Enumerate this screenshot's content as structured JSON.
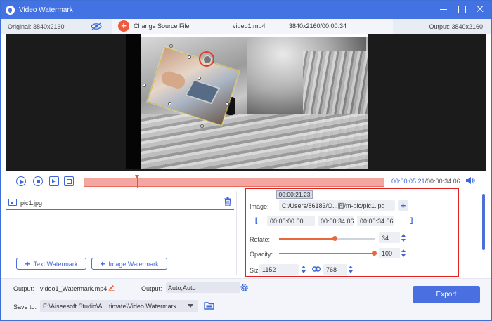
{
  "window": {
    "title": "Video Watermark"
  },
  "info": {
    "original": "Original: 3840x2160",
    "change_source": "Change Source File",
    "file_name": "video1.mp4",
    "file_meta": "3840x2160/00:00:34",
    "output": "Output: 3840x2160"
  },
  "playback": {
    "current_time": "00:00:05.21",
    "total_time": "/00:00:34.06",
    "tooltip_time": "00:00:21.23",
    "playhead_progress": 0.175
  },
  "watermark_list": {
    "items": [
      {
        "name": "pic1.jpg"
      }
    ],
    "text_btn": "Text Watermark",
    "image_btn": "Image Watermark"
  },
  "settings": {
    "image_label": "Image:",
    "image_path": "C:/Users/86183/O...面/m-pic/pic1.jpg",
    "start_time": "00:00:00.00",
    "end_time": "00:00:34.06",
    "duration": "00:00:34.06",
    "rotate_label": "Rotate:",
    "rotate_value": "34",
    "rotate_fraction": 0.58,
    "opacity_label": "Opacity:",
    "opacity_value": "100",
    "opacity_fraction": 1.0,
    "size_label": "Size:",
    "width": "1152",
    "height": "768"
  },
  "bottom": {
    "output_label": "Output:",
    "output_name": "video1_Watermark.mp4",
    "output2_label": "Output:",
    "output_format": "Auto;Auto",
    "save_to_label": "Save to:",
    "save_path": "E:\\Aiseesoft Studio\\Ai...timate\\Video Watermark",
    "export_label": "Export"
  },
  "colors": {
    "accent": "#4372e3",
    "highlight_box": "#e0211f",
    "slider": "#e8673c"
  }
}
